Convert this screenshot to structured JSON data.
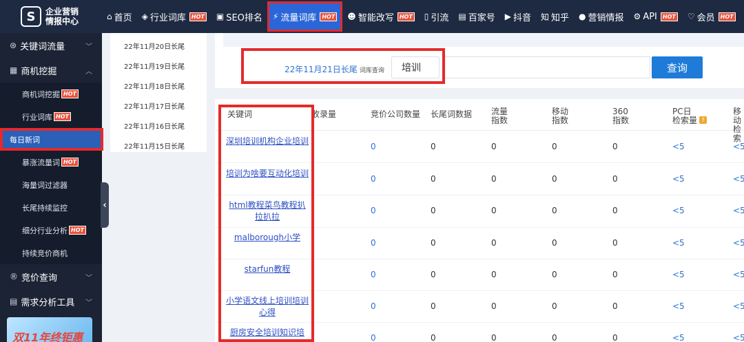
{
  "logo": {
    "mark": "S",
    "line1": "企业营销",
    "line2": "情报中心"
  },
  "nav": [
    {
      "icon": "⌂",
      "icon_name": "home-icon",
      "label": "首页",
      "hot": false
    },
    {
      "icon": "◈",
      "icon_name": "cube-icon",
      "label": "行业词库",
      "hot": true
    },
    {
      "icon": "▣",
      "icon_name": "monitor-icon",
      "label": "SEO排名",
      "hot": false
    },
    {
      "icon": "⚡",
      "icon_name": "traffic-icon",
      "label": "流量词库",
      "hot": true,
      "active": true
    },
    {
      "icon": "☻",
      "icon_name": "robot-icon",
      "label": "智能改写",
      "hot": true
    },
    {
      "icon": "▯",
      "icon_name": "phone-icon",
      "label": "引流",
      "hot": false
    },
    {
      "icon": "▤",
      "icon_name": "baijiahao-icon",
      "label": "百家号",
      "hot": false
    },
    {
      "icon": "▶",
      "icon_name": "video-icon",
      "label": "抖音",
      "hot": false
    },
    {
      "icon": "知",
      "icon_name": "zhihu-icon",
      "label": "知乎",
      "hot": false
    },
    {
      "icon": "●",
      "icon_name": "chat-icon",
      "label": "营销情报",
      "hot": false
    },
    {
      "icon": "⚙",
      "icon_name": "api-icon",
      "label": "API",
      "hot": true
    },
    {
      "icon": "♡",
      "icon_name": "diamond-icon",
      "label": "会员",
      "hot": true
    }
  ],
  "hot_label": "HOT",
  "sidebar": {
    "group_keyword": "关键词流量",
    "group_business": "商机挖掘",
    "subitems": [
      {
        "label": "商机词挖掘",
        "hot": true
      },
      {
        "label": "行业词库",
        "hot": true
      },
      {
        "label": "每日新词",
        "hot": false,
        "active": true
      },
      {
        "label": "暴涨流量词",
        "hot": true
      },
      {
        "label": "海量词过滤器",
        "hot": false
      },
      {
        "label": "长尾持续监控",
        "hot": false
      },
      {
        "label": "细分行业分析",
        "hot": true
      },
      {
        "label": "持续竞价商机",
        "hot": false
      }
    ],
    "group_bid": "竞价查询",
    "group_demand": "需求分析工具",
    "banner_text": "双11年终钜惠"
  },
  "dates": [
    "22年11月20日长尾",
    "22年11月19日长尾",
    "22年11月18日长尾",
    "22年11月17日长尾",
    "22年11月16日长尾",
    "22年11月15日长尾"
  ],
  "search": {
    "date_label": "22年11月21日长尾",
    "sub_label": "词库查询",
    "value": "培训",
    "button": "查询"
  },
  "table": {
    "headers": {
      "keyword": "关键词",
      "indexed": "收录量",
      "bid_companies": "竞价公司数量",
      "longtail": "长尾词数据",
      "traffic": "流量\n指数",
      "mobile": "移动\n指数",
      "index360": "360\n指数",
      "pc_daily": "PC日\n检索量",
      "mobile_daily": "移动\n检索"
    },
    "rows": [
      {
        "keyword": "深圳培训机构企业培训",
        "bid": "0",
        "longtail": "0",
        "traffic": "0",
        "mobile": "0",
        "i360": "0",
        "pc": "<5",
        "mob": "<5"
      },
      {
        "keyword": "培训为啥要互动化培训",
        "bid": "0",
        "longtail": "0",
        "traffic": "0",
        "mobile": "0",
        "i360": "0",
        "pc": "<5",
        "mob": "<5"
      },
      {
        "keyword": "html教程菜鸟教程扒拉扒拉",
        "bid": "0",
        "longtail": "0",
        "traffic": "0",
        "mobile": "0",
        "i360": "0",
        "pc": "<5",
        "mob": "<5"
      },
      {
        "keyword": "malborough小学",
        "bid": "0",
        "longtail": "0",
        "traffic": "0",
        "mobile": "0",
        "i360": "0",
        "pc": "<5",
        "mob": "<5"
      },
      {
        "keyword": "starfun教程",
        "bid": "0",
        "longtail": "0",
        "traffic": "0",
        "mobile": "0",
        "i360": "0",
        "pc": "<5",
        "mob": "<5"
      },
      {
        "keyword": "小学语文线上培训培训心得",
        "bid": "0",
        "longtail": "0",
        "traffic": "0",
        "mobile": "0",
        "i360": "0",
        "pc": "<5",
        "mob": "<5"
      },
      {
        "keyword": "厨房安全培训知识培",
        "bid": "0",
        "longtail": "0",
        "traffic": "0",
        "mobile": "0",
        "i360": "0",
        "pc": "<5",
        "mob": "<5"
      }
    ]
  }
}
